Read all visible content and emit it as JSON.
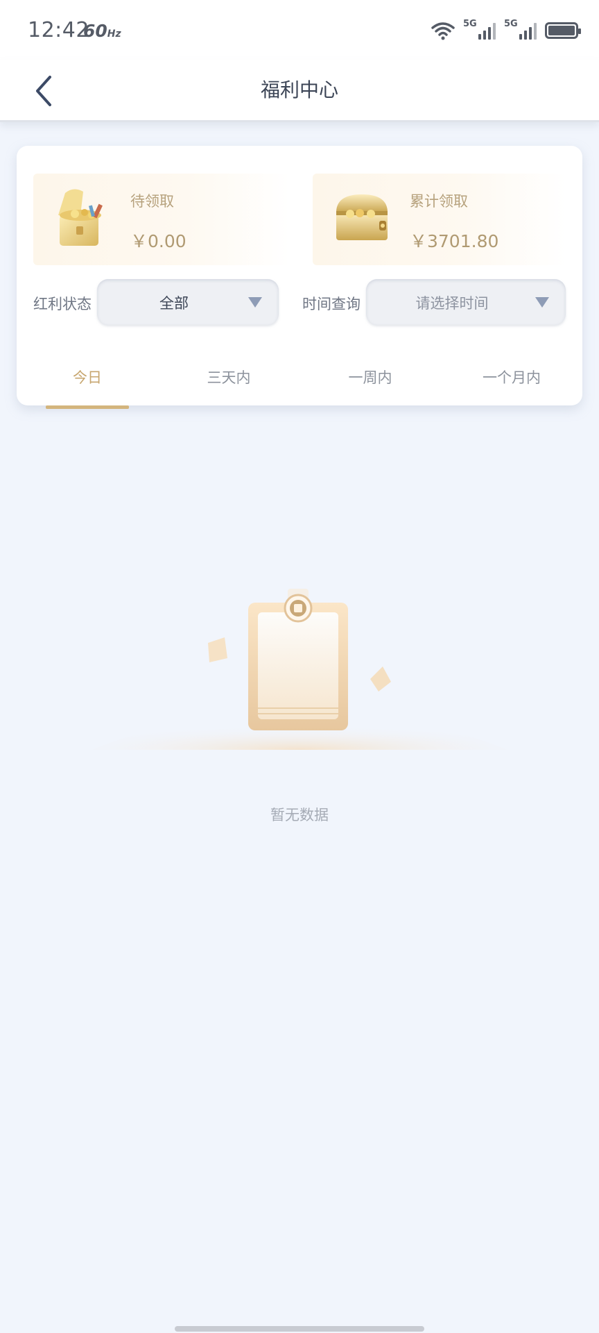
{
  "status_bar": {
    "time": "12:42",
    "refresh_rate": "60",
    "refresh_unit": "Hz",
    "signal_1": "5G",
    "signal_2": "5G"
  },
  "nav": {
    "title": "福利中心",
    "back_icon": "chevron-left-icon"
  },
  "summary": {
    "pending": {
      "label": "待领取",
      "value": "￥0.00",
      "icon": "treasure-chest-open-icon"
    },
    "total": {
      "label": "累计领取",
      "value": "￥3701.80",
      "icon": "treasure-chest-closed-icon"
    }
  },
  "filters": {
    "status_label": "红利状态",
    "status_value": "全部",
    "time_label": "时间查询",
    "time_placeholder": "请选择时间"
  },
  "tabs": [
    {
      "label": "今日",
      "active": true
    },
    {
      "label": "三天内",
      "active": false
    },
    {
      "label": "一周内",
      "active": false
    },
    {
      "label": "一个月内",
      "active": false
    }
  ],
  "empty_state": {
    "text": "暂无数据",
    "icon": "empty-clipboard-icon"
  },
  "colors": {
    "accent": "#c7a66f",
    "background": "#f1f5fc",
    "title": "#3c4556"
  }
}
